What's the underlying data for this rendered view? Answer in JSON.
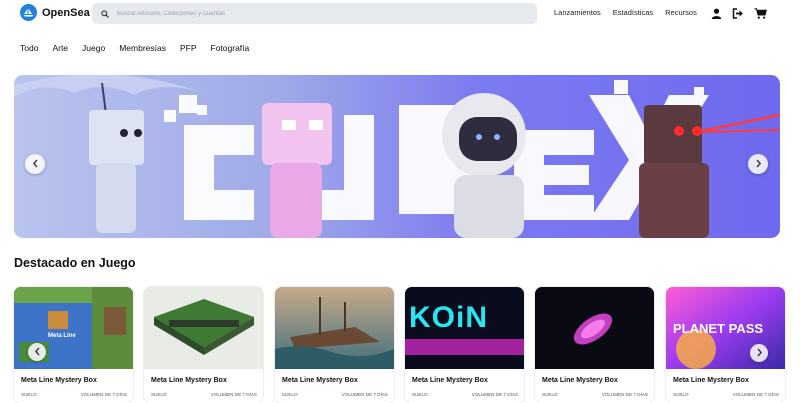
{
  "header": {
    "logo_text": "OpenSea",
    "search_placeholder": "Buscar Artículos, Colecciones y Cuentas",
    "links": [
      "Lanzamientos",
      "Estadísticas",
      "Recursos"
    ],
    "icons": [
      "user-icon",
      "logout-icon",
      "cart-icon"
    ]
  },
  "categories": [
    "Todo",
    "Arte",
    "Juego",
    "Membresías",
    "PFP",
    "Fotografía"
  ],
  "section_title": "Destacado en Juego",
  "cards": [
    {
      "name": "Meta Line Mystery Box",
      "floor_label": "SUELO",
      "volume_label": "VOLUMEN DE 7 DÍAS",
      "art_text": "Meta Line"
    },
    {
      "name": "Meta Line Mystery Box",
      "floor_label": "SUELO",
      "volume_label": "VOLUMEN DE 7 DÍAS",
      "art_text": ""
    },
    {
      "name": "Meta Line Mystery Box",
      "floor_label": "SUELO",
      "volume_label": "VOLUMEN DE 7 DÍAS",
      "art_text": ""
    },
    {
      "name": "Meta Line Mystery Box",
      "floor_label": "SUELO",
      "volume_label": "VOLUMEN DE 7 DÍAS",
      "art_text": "KOiN"
    },
    {
      "name": "Meta Line Mystery Box",
      "floor_label": "SUELO",
      "volume_label": "VOLUMEN DE 7 DÍAS",
      "art_text": ""
    },
    {
      "name": "Meta Line Mystery Box",
      "floor_label": "SUELO",
      "volume_label": "VOLUMEN DE 7 DÍAS",
      "art_text": "PLANET PASS"
    }
  ],
  "colors": {
    "brand": "#2081e2",
    "search_bg": "#e6e9ee",
    "hero_bg": "#8f96ec"
  }
}
